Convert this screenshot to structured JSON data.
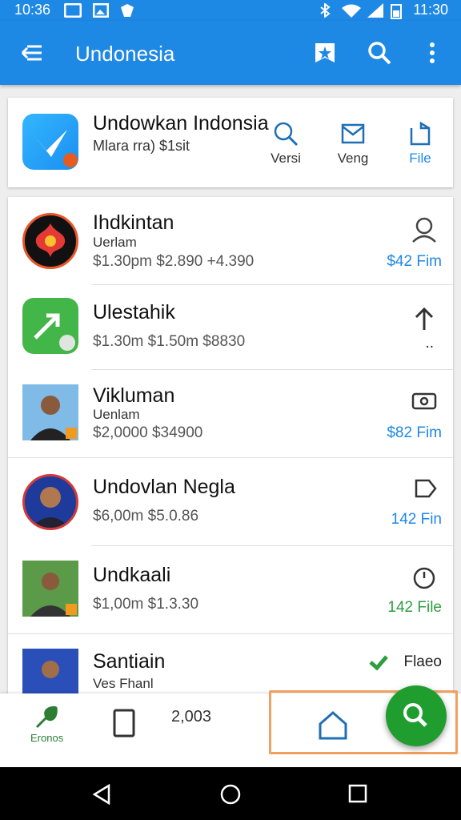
{
  "status_bar": {
    "time_left": "10:36",
    "time_right": "11:30"
  },
  "app_bar": {
    "title": "Undonesia"
  },
  "top_card": {
    "title": "Undowkan Indonsia",
    "subtitle": "Mlara rra) $1sit",
    "actions": [
      {
        "label": "Versi",
        "icon": "search-icon"
      },
      {
        "label": "Veng",
        "icon": "mail-icon"
      },
      {
        "label": "File",
        "icon": "file-icon"
      }
    ]
  },
  "list": [
    {
      "name": "Ihdkintan",
      "sub": "Uerlam",
      "prices": "$1.30pm  $2.890  +4.390",
      "right_label": "$42 Fim",
      "right_icon": "user-icon"
    },
    {
      "name": "Ulestahik",
      "sub": "",
      "prices": "$1.30m  $1.50m  $8830",
      "right_label": "..",
      "right_icon": "arrow-up-icon"
    },
    {
      "name": "Vikluman",
      "sub": "Uenlam",
      "prices": "$2,0000  $34900",
      "right_label": "$82 Fim",
      "right_icon": "camera-icon"
    },
    {
      "name": "Undovlan Negla",
      "sub": "",
      "prices": "$6,00m  $5.0.86",
      "right_label": "142 Fin",
      "right_icon": "tag-icon"
    },
    {
      "name": "Undkaali",
      "sub": "",
      "prices": "$1,00m  $1.3.30",
      "right_label": "142 File",
      "right_icon": "clock-icon"
    },
    {
      "name": "Santiain",
      "sub": "Ves Fhanl",
      "prices": "",
      "right_label": "Flaeo",
      "right_icon": "check-icon"
    }
  ],
  "bottom_bar": {
    "left_label": "Eronos",
    "count": "2,003"
  },
  "colors": {
    "primary": "#1e88e5",
    "accent_green": "#1f9d2f",
    "highlight": "#f0a060"
  }
}
